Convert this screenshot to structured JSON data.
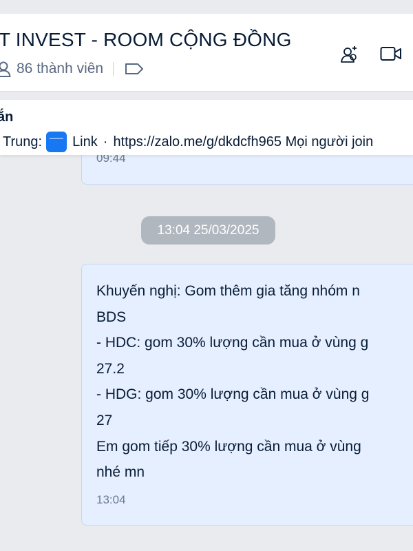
{
  "header": {
    "title": "T INVEST - ROOM CỘNG ĐỒNG",
    "members_label": "86 thành viên",
    "icons": [
      "members-icon",
      "tag-icon",
      "add-member-icon",
      "video-call-icon"
    ]
  },
  "pinned": {
    "title": "ắn",
    "sender": "Trung:",
    "link_label": "Link",
    "separator": "·",
    "content": "https://zalo.me/g/dkdcfh965 Mọi người join"
  },
  "messages": {
    "prev_time": "09:44",
    "date_divider": "13:04 25/03/2025",
    "main": {
      "lines": [
        "Khuyến nghị: Gom thêm gia tăng nhóm n",
        "BDS",
        "- HDC: gom 30% lượng cần mua ở vùng g",
        "27.2",
        "- HDG: gom 30% lượng cần mua ở vùng g",
        "27",
        "Em gom tiếp 30% lượng cần mua ở vùng",
        "nhé mn"
      ],
      "time": "13:04"
    }
  },
  "colors": {
    "background": "#e9ebee",
    "bubble": "#e5efff",
    "bubble_border": "#c2d7f5",
    "text": "#081c36",
    "muted": "#6b7a8f",
    "link_thumb": "#1877f2"
  }
}
